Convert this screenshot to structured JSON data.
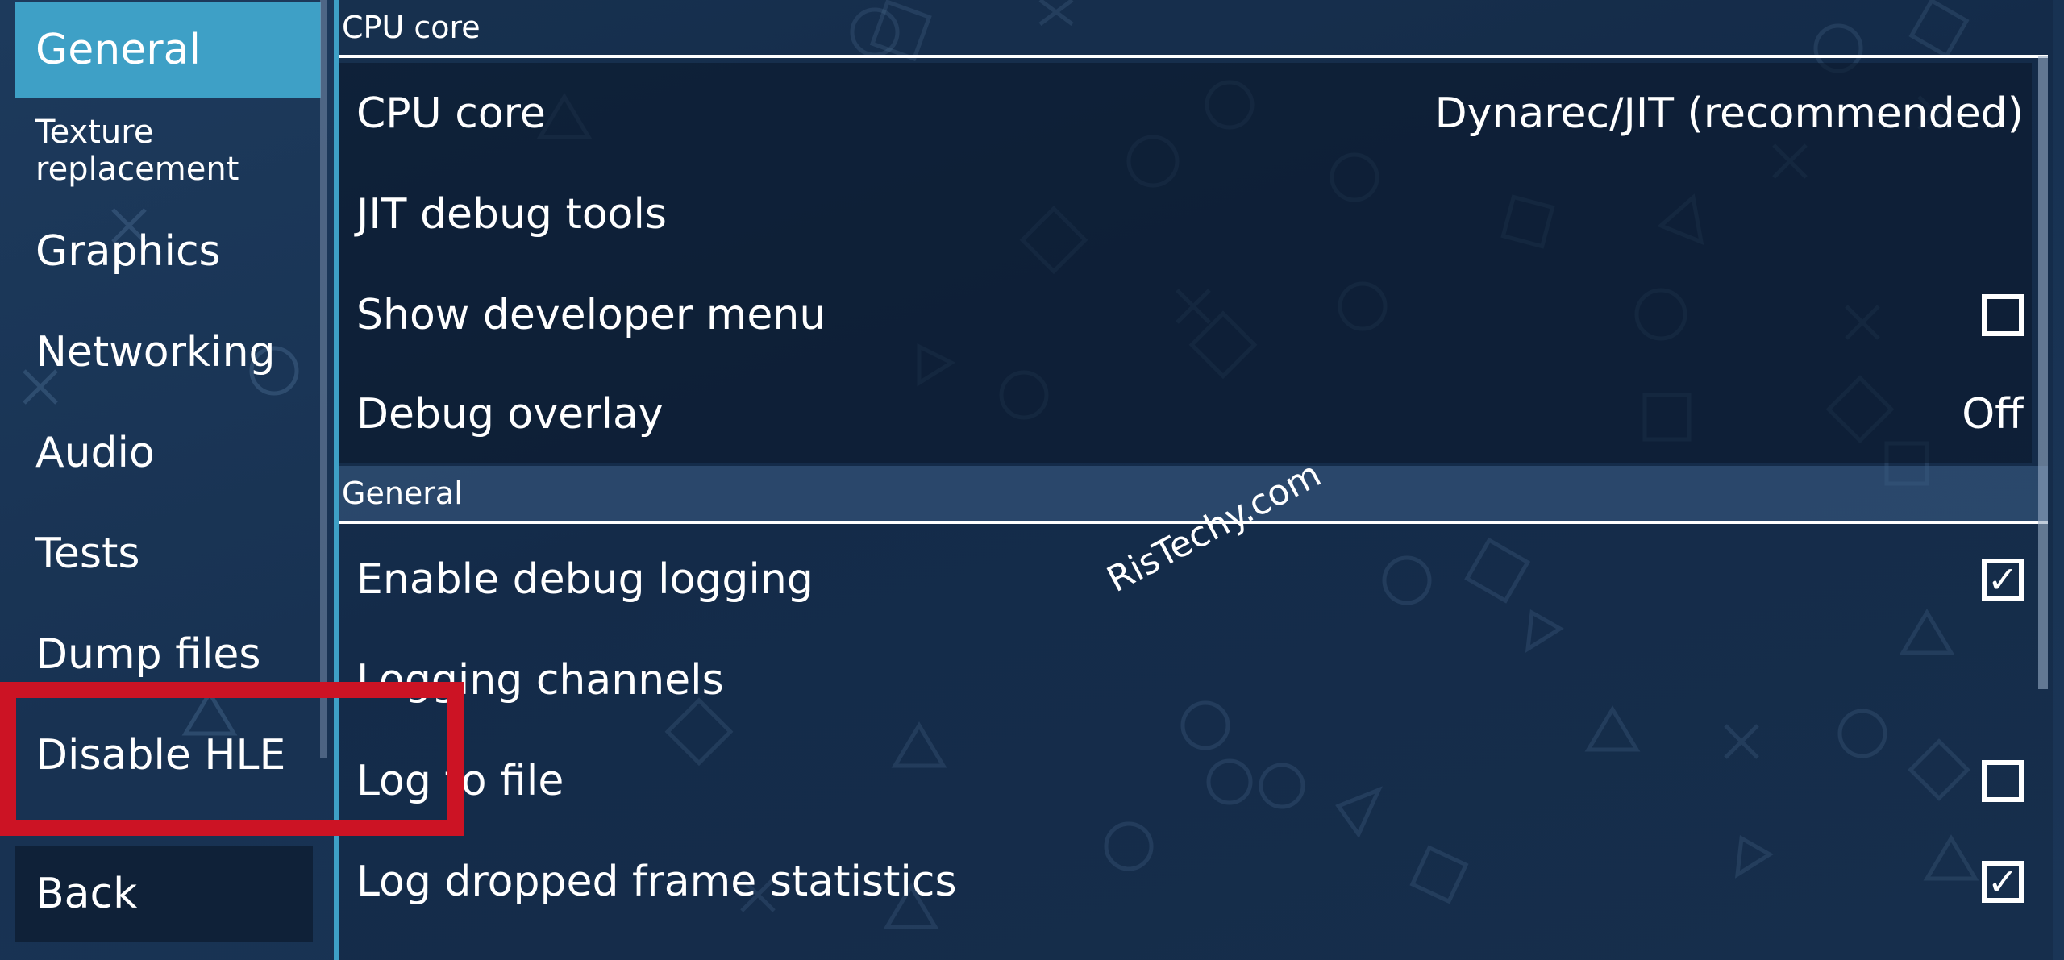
{
  "sidebar": {
    "items": [
      {
        "label": "General"
      },
      {
        "label": "Texture replacement"
      },
      {
        "label": "Graphics"
      },
      {
        "label": "Networking"
      },
      {
        "label": "Audio"
      },
      {
        "label": "Tests"
      },
      {
        "label": "Dump files"
      },
      {
        "label": "Disable HLE"
      }
    ],
    "back_label": "Back"
  },
  "sections": [
    {
      "title": "CPU core",
      "rows": [
        {
          "label": "CPU core",
          "value": "Dynarec/JIT (recommended)"
        },
        {
          "label": "JIT debug tools"
        },
        {
          "label": "Show developer menu",
          "checked": false
        },
        {
          "label": "Debug overlay",
          "value": "Off"
        }
      ]
    },
    {
      "title": "General",
      "rows": [
        {
          "label": "Enable debug logging",
          "checked": true
        },
        {
          "label": "Logging channels"
        },
        {
          "label": "Log to file",
          "checked": false
        },
        {
          "label": "Log dropped frame statistics",
          "checked": true
        }
      ]
    }
  ],
  "watermark": "RisTechy.com",
  "colors": {
    "accent": "#3ea0c6",
    "annotation": "#cc1324",
    "background": "#1b3556"
  }
}
